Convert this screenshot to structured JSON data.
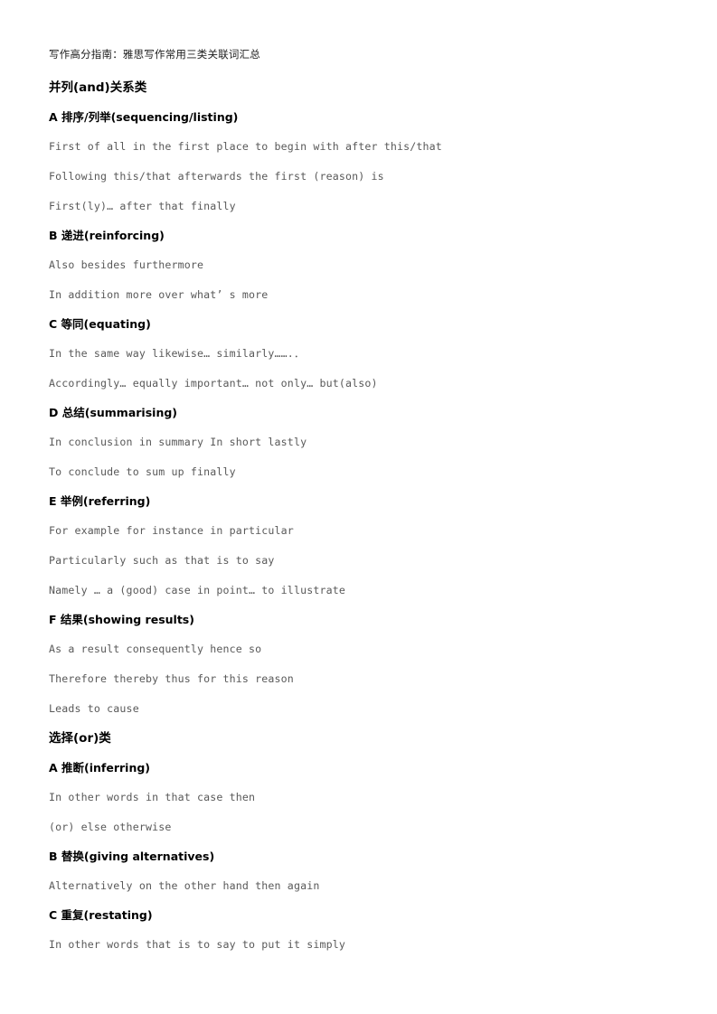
{
  "document": {
    "title": "写作高分指南：雅思写作常用三类关联词汇总",
    "sections": [
      {
        "heading": "并列(and)关系类",
        "subsections": [
          {
            "heading": "A 排序/列举(sequencing/listing)",
            "lines": [
              "First of all in the first place to begin with after this/that",
              "Following this/that afterwards the first (reason) is",
              "First(ly)… after that finally"
            ]
          },
          {
            "heading": "B 递进(reinforcing)",
            "lines": [
              "Also besides furthermore",
              "In addition more over what’ s more"
            ]
          },
          {
            "heading": "C 等同(equating)",
            "lines": [
              "In the same way likewise… similarly…….．",
              "Accordingly… equally important… not only… but(also)"
            ]
          },
          {
            "heading": "D 总结(summarising)",
            "lines": [
              "In conclusion in summary In short lastly",
              "To conclude to sum up finally"
            ]
          },
          {
            "heading": "E 举例(referring)",
            "lines": [
              "For example for instance in particular",
              "Particularly such as that is to say",
              "Namely … a (good) case in point… to illustrate"
            ]
          },
          {
            "heading": "F 结果(showing results)",
            "lines": [
              "As a result consequently hence so",
              "Therefore thereby thus for this reason",
              "Leads to cause"
            ]
          }
        ]
      },
      {
        "heading": "选择(or)类",
        "subsections": [
          {
            "heading": "A 推断(inferring)",
            "lines": [
              "In other words in that case then",
              "(or) else otherwise"
            ]
          },
          {
            "heading": "B 替换(giving alternatives)",
            "lines": [
              "Alternatively on the other hand then again"
            ]
          },
          {
            "heading": "C 重复(restating)",
            "lines": [
              "In other words that is to say to put it simply"
            ]
          }
        ]
      }
    ]
  }
}
